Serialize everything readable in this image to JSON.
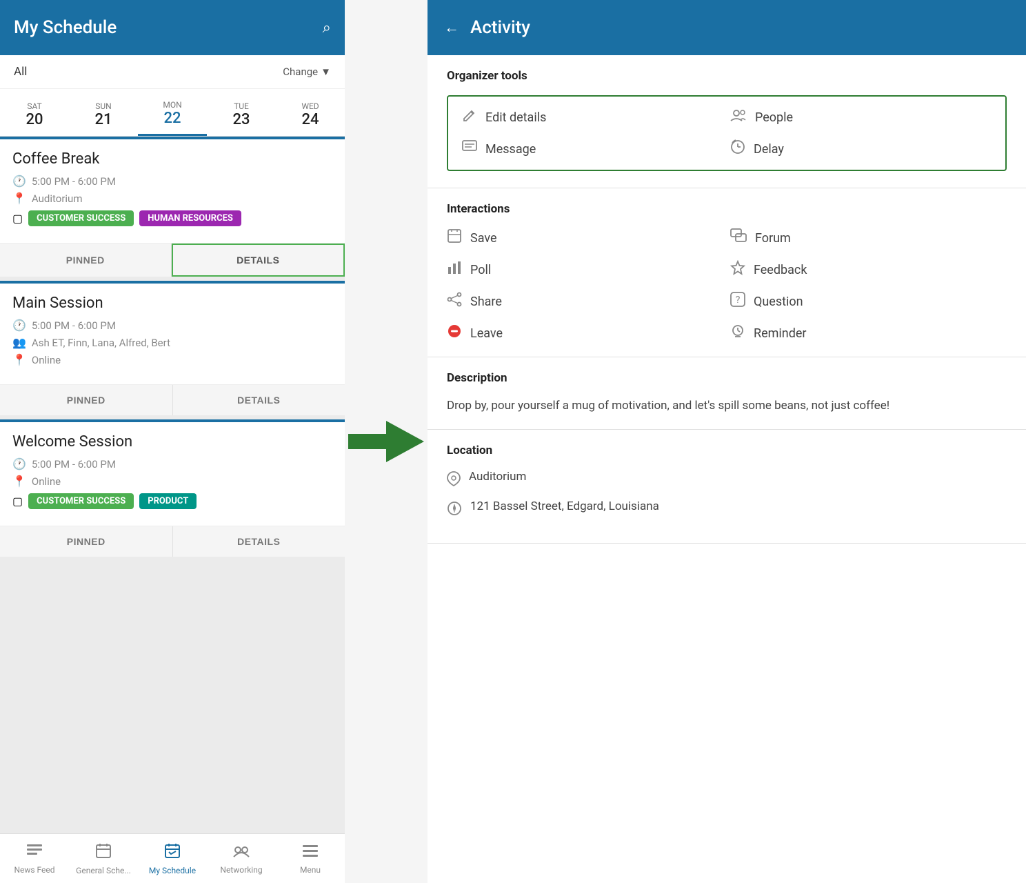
{
  "left": {
    "header": {
      "title": "My Schedule",
      "search_icon": "🔍"
    },
    "filter": {
      "label": "All",
      "change_label": "Change",
      "change_icon": "▼"
    },
    "dates": [
      {
        "day": "SAT",
        "num": "20",
        "active": false
      },
      {
        "day": "SUN",
        "num": "21",
        "active": false
      },
      {
        "day": "MON",
        "num": "22",
        "active": true
      },
      {
        "day": "TUE",
        "num": "23",
        "active": false
      },
      {
        "day": "WED",
        "num": "24",
        "active": false
      }
    ],
    "cards": [
      {
        "id": "coffee-break",
        "title": "Coffee Break",
        "time": "5:00 PM - 6:00 PM",
        "location": "Auditorium",
        "tags": [
          {
            "label": "CUSTOMER SUCCESS",
            "color": "green"
          },
          {
            "label": "HUMAN RESOURCES",
            "color": "purple"
          }
        ],
        "pinned_label": "PINNED",
        "details_label": "DETAILS",
        "details_active": true,
        "has_people": false
      },
      {
        "id": "main-session",
        "title": "Main Session",
        "time": "5:00 PM - 6:00 PM",
        "people": "Ash ET, Finn, Lana, Alfred, Bert",
        "location": "Online",
        "tags": [],
        "pinned_label": "PINNED",
        "details_label": "DETAILS",
        "details_active": false,
        "has_people": true
      },
      {
        "id": "welcome-session",
        "title": "Welcome Session",
        "time": "5:00 PM - 6:00 PM",
        "location": "Online",
        "tags": [
          {
            "label": "CUSTOMER SUCCESS",
            "color": "green"
          },
          {
            "label": "PRODUCT",
            "color": "teal"
          }
        ],
        "pinned_label": "PINNED",
        "details_label": "DETAILS",
        "details_active": false,
        "has_people": false
      }
    ],
    "bottom_nav": [
      {
        "id": "news-feed",
        "label": "News Feed",
        "icon": "≡",
        "active": false
      },
      {
        "id": "general-schedule",
        "label": "General Sche...",
        "icon": "📅",
        "active": false
      },
      {
        "id": "my-schedule",
        "label": "My Schedule",
        "icon": "📆",
        "active": true
      },
      {
        "id": "networking",
        "label": "Networking",
        "icon": "👥",
        "active": false
      },
      {
        "id": "menu",
        "label": "Menu",
        "icon": "☰",
        "active": false
      }
    ]
  },
  "right": {
    "header": {
      "back_icon": "←",
      "title": "Activity"
    },
    "organizer_tools": {
      "section_title": "Organizer tools",
      "tools": [
        {
          "id": "edit-details",
          "label": "Edit details",
          "icon": "✏️"
        },
        {
          "id": "people",
          "label": "People",
          "icon": "👥"
        },
        {
          "id": "message",
          "label": "Message",
          "icon": "💬"
        },
        {
          "id": "delay",
          "label": "Delay",
          "icon": "⏱️"
        }
      ]
    },
    "interactions": {
      "section_title": "Interactions",
      "items": [
        {
          "id": "save",
          "label": "Save",
          "icon": "📅",
          "type": "normal"
        },
        {
          "id": "forum",
          "label": "Forum",
          "icon": "💬",
          "type": "normal"
        },
        {
          "id": "poll",
          "label": "Poll",
          "icon": "📊",
          "type": "normal"
        },
        {
          "id": "feedback",
          "label": "Feedback",
          "icon": "⭐",
          "type": "normal"
        },
        {
          "id": "share",
          "label": "Share",
          "icon": "↗",
          "type": "normal"
        },
        {
          "id": "question",
          "label": "Question",
          "icon": "❓",
          "type": "normal"
        },
        {
          "id": "leave",
          "label": "Leave",
          "icon": "⊖",
          "type": "leave"
        },
        {
          "id": "reminder",
          "label": "Reminder",
          "icon": "⏰",
          "type": "normal"
        }
      ]
    },
    "description": {
      "section_title": "Description",
      "text": "Drop by, pour yourself a mug of motivation, and let's spill some beans, not just coffee!"
    },
    "location": {
      "section_title": "Location",
      "items": [
        {
          "id": "loc-name",
          "icon": "📍",
          "text": "Auditorium"
        },
        {
          "id": "loc-address",
          "icon": "🧭",
          "text": "121 Bassel Street, Edgard, Louisiana"
        }
      ]
    }
  }
}
